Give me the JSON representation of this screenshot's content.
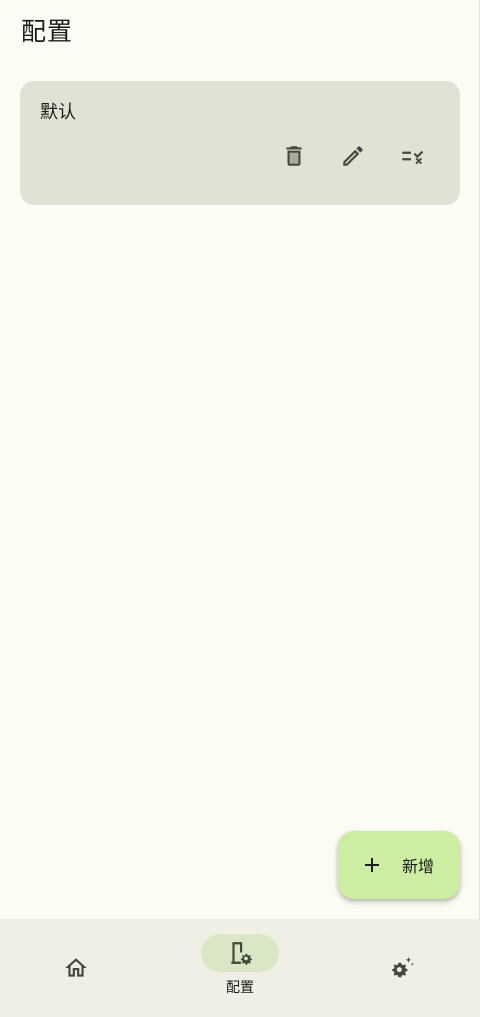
{
  "header": {
    "title": "配置"
  },
  "profiles": [
    {
      "name": "默认",
      "actions": {
        "delete": "delete-icon",
        "edit": "edit-icon",
        "select": "playlist-remove-icon"
      }
    }
  ],
  "fab": {
    "icon": "plus-icon",
    "label": "新增"
  },
  "bottom_nav": {
    "items": [
      {
        "icon": "home-icon",
        "label": "",
        "selected": false
      },
      {
        "icon": "config-device-settings-icon",
        "label": "配置",
        "selected": true
      },
      {
        "icon": "settings-sparkle-icon",
        "label": "",
        "selected": false
      }
    ]
  },
  "colors": {
    "background": "#fcfcf4",
    "card": "#e1e2d4",
    "fab": "#cdeda3",
    "nav_background": "#efefe6",
    "nav_indicator": "#d9e7c6",
    "icon": "#45483d",
    "text": "#1b1c17"
  }
}
